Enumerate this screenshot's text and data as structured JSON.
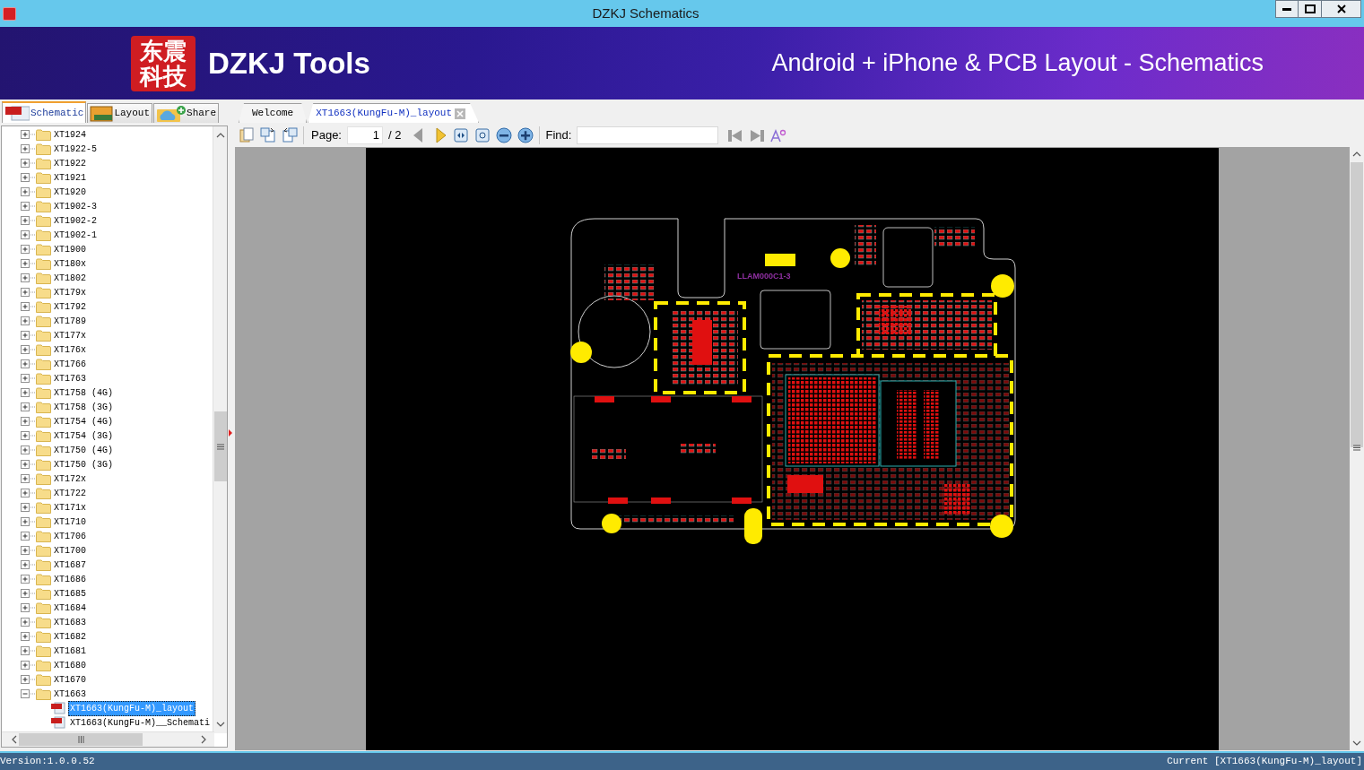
{
  "window": {
    "title": "DZKJ Schematics"
  },
  "banner": {
    "logo_text": "东震科技",
    "brand": "DZKJ Tools",
    "tagline": "Android + iPhone & PCB Layout - Schematics"
  },
  "side_tabs": [
    {
      "label": "Schematic",
      "kind": "pdf",
      "selected": true
    },
    {
      "label": "Layout",
      "kind": "pads",
      "selected": false
    },
    {
      "label": "Share",
      "kind": "share",
      "selected": false
    }
  ],
  "doc_tabs": [
    {
      "label": "Welcome",
      "selected": false,
      "closable": false
    },
    {
      "label": "XT1663(KungFu-M)_layout",
      "selected": true,
      "closable": true
    }
  ],
  "toolbar": {
    "page_label": "Page:",
    "page_value": "1",
    "page_total": "/ 2",
    "find_label": "Find:"
  },
  "tree": [
    {
      "label": "XT1924",
      "expanded": false
    },
    {
      "label": "XT1922-5",
      "expanded": false
    },
    {
      "label": "XT1922",
      "expanded": false
    },
    {
      "label": "XT1921",
      "expanded": false
    },
    {
      "label": "XT1920",
      "expanded": false
    },
    {
      "label": "XT1902-3",
      "expanded": false
    },
    {
      "label": "XT1902-2",
      "expanded": false
    },
    {
      "label": "XT1902-1",
      "expanded": false
    },
    {
      "label": "XT1900",
      "expanded": false
    },
    {
      "label": "XT180x",
      "expanded": false
    },
    {
      "label": "XT1802",
      "expanded": false
    },
    {
      "label": "XT179x",
      "expanded": false
    },
    {
      "label": "XT1792",
      "expanded": false
    },
    {
      "label": "XT1789",
      "expanded": false
    },
    {
      "label": "XT177x",
      "expanded": false
    },
    {
      "label": "XT176x",
      "expanded": false
    },
    {
      "label": "XT1766",
      "expanded": false
    },
    {
      "label": "XT1763",
      "expanded": false
    },
    {
      "label": "XT1758 (4G)",
      "expanded": false
    },
    {
      "label": "XT1758 (3G)",
      "expanded": false
    },
    {
      "label": "XT1754 (4G)",
      "expanded": false
    },
    {
      "label": "XT1754 (3G)",
      "expanded": false
    },
    {
      "label": "XT1750 (4G)",
      "expanded": false
    },
    {
      "label": "XT1750 (3G)",
      "expanded": false
    },
    {
      "label": "XT172x",
      "expanded": false
    },
    {
      "label": "XT1722",
      "expanded": false
    },
    {
      "label": "XT171x",
      "expanded": false
    },
    {
      "label": "XT1710",
      "expanded": false
    },
    {
      "label": "XT1706",
      "expanded": false
    },
    {
      "label": "XT1700",
      "expanded": false
    },
    {
      "label": "XT1687",
      "expanded": false
    },
    {
      "label": "XT1686",
      "expanded": false
    },
    {
      "label": "XT1685",
      "expanded": false
    },
    {
      "label": "XT1684",
      "expanded": false
    },
    {
      "label": "XT1683",
      "expanded": false
    },
    {
      "label": "XT1682",
      "expanded": false
    },
    {
      "label": "XT1681",
      "expanded": false
    },
    {
      "label": "XT1680",
      "expanded": false
    },
    {
      "label": "XT1670",
      "expanded": false
    },
    {
      "label": "XT1663",
      "expanded": true,
      "children": [
        {
          "label": "XT1663(KungFu-M)_layout",
          "selected": true
        },
        {
          "label": "XT1663(KungFu-M)__Schemati",
          "selected": false
        }
      ]
    }
  ],
  "document": {
    "board_label": "LLAM000C1-3"
  },
  "status_bar": {
    "version": "Version:1.0.0.52",
    "current": "Current [XT1663(KungFu-M)_layout]"
  }
}
